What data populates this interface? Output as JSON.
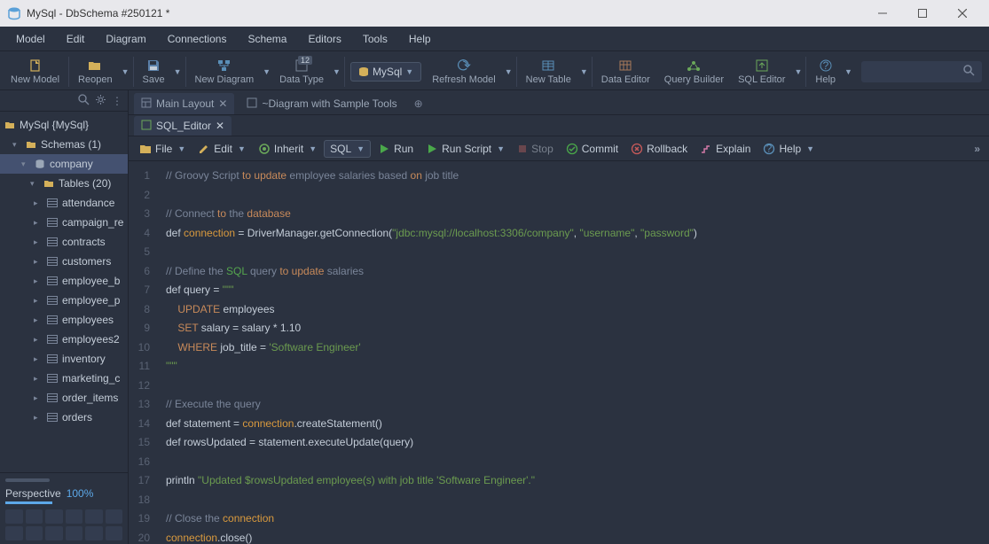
{
  "window": {
    "title": "MySql - DbSchema #250121 *"
  },
  "menubar": [
    "Model",
    "Edit",
    "Diagram",
    "Connections",
    "Schema",
    "Editors",
    "Tools",
    "Help"
  ],
  "toolbar": {
    "new_model": "New Model",
    "reopen": "Reopen",
    "save": "Save",
    "new_diagram": "New Diagram",
    "data_type": "Data Type",
    "data_type_badge": "12",
    "mysql_btn": "MySql",
    "refresh_model": "Refresh Model",
    "new_table": "New Table",
    "data_editor": "Data Editor",
    "query_builder": "Query Builder",
    "sql_editor": "SQL Editor",
    "help": "Help"
  },
  "sidebar": {
    "root": "MySql {MySql}",
    "schemas_label": "Schemas (1)",
    "db": "company",
    "tables_label": "Tables (20)",
    "tables": [
      "attendance",
      "campaign_re",
      "contracts",
      "customers",
      "employee_b",
      "employee_p",
      "employees",
      "employees2",
      "inventory",
      "marketing_c",
      "order_items",
      "orders"
    ],
    "perspective_label": "Perspective",
    "perspective_value": "100%"
  },
  "tabs1": {
    "main_layout": "Main Layout",
    "diagram_sample": "~Diagram with Sample Tools"
  },
  "tabs2": {
    "sql_editor": "SQL_Editor"
  },
  "editor_toolbar": {
    "file": "File",
    "edit": "Edit",
    "inherit": "Inherit",
    "sql": "SQL",
    "run": "Run",
    "run_script": "Run Script",
    "stop": "Stop",
    "commit": "Commit",
    "rollback": "Rollback",
    "explain": "Explain",
    "help": "Help"
  },
  "code": {
    "l1_a": "// Groovy Script ",
    "l1_b": "to",
    "l1_c": " ",
    "l1_d": "update",
    "l1_e": " employee salaries based ",
    "l1_f": "on",
    "l1_g": " job title",
    "l3_a": "// Connect ",
    "l3_b": "to",
    "l3_c": " the ",
    "l3_d": "database",
    "l4_a": "def ",
    "l4_b": "connection",
    "l4_c": " = DriverManager.getConnection(",
    "l4_d": "\"jdbc:mysql://localhost:3306/company\"",
    "l4_e": ", ",
    "l4_f": "\"username\"",
    "l4_g": ", ",
    "l4_h": "\"password\"",
    "l4_i": ")",
    "l6_a": "// Define the ",
    "l6_b": "SQL",
    "l6_c": " query ",
    "l6_d": "to",
    "l6_e": " ",
    "l6_f": "update",
    "l6_g": " salaries",
    "l7_a": "def query = ",
    "l7_b": "\"\"\"",
    "l8_a": "    ",
    "l8_b": "UPDATE",
    "l8_c": " employees",
    "l9_a": "    ",
    "l9_b": "SET",
    "l9_c": " salary = salary * 1.10",
    "l10_a": "    ",
    "l10_b": "WHERE",
    "l10_c": " job_title = ",
    "l10_d": "'Software Engineer'",
    "l11_a": "\"\"\"",
    "l13_a": "// Execute the query",
    "l14_a": "def statement = ",
    "l14_b": "connection",
    "l14_c": ".createStatement()",
    "l15_a": "def rowsUpdated = statement.executeUpdate(query)",
    "l17_a": "println ",
    "l17_b": "\"Updated $rowsUpdated employee(s) with job title 'Software Engineer'.\"",
    "l19_a": "// Close the ",
    "l19_b": "connection",
    "l20_a": "connection",
    "l20_b": ".close()"
  },
  "line_numbers": [
    "1",
    "2",
    "3",
    "4",
    "5",
    "6",
    "7",
    "8",
    "9",
    "10",
    "11",
    "12",
    "13",
    "14",
    "15",
    "16",
    "17",
    "18",
    "19",
    "20"
  ]
}
